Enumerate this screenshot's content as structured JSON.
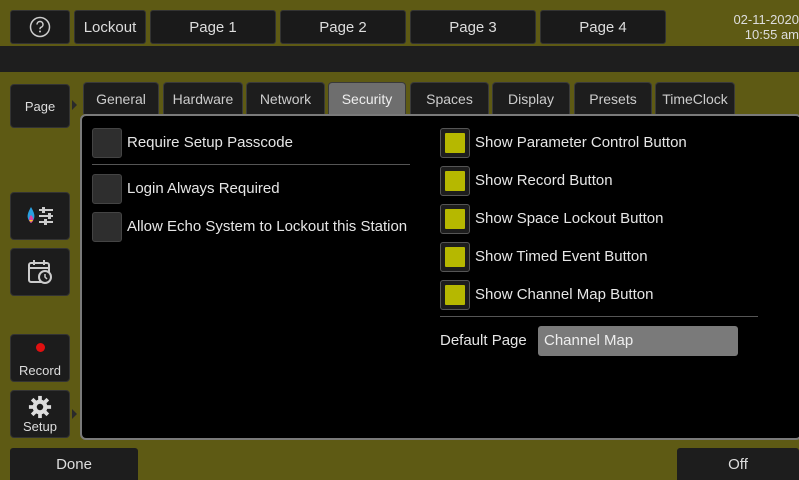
{
  "topbar": {
    "help_icon": "question-circle-icon",
    "lockout_label": "Lockout",
    "pages": [
      "Page 1",
      "Page 2",
      "Page 3",
      "Page 4"
    ],
    "date": "02-11-2020",
    "time": "10:55 am"
  },
  "sidebar": {
    "page_label": "Page",
    "record_label": "Record",
    "setup_label": "Setup",
    "record_dot_color": "#e01010"
  },
  "tabs": [
    "General",
    "Hardware",
    "Network",
    "Security",
    "Spaces",
    "Display",
    "Presets",
    "TimeClock"
  ],
  "active_tab": "Security",
  "security": {
    "left_options": [
      {
        "label": "Require Setup Passcode",
        "checked": false
      },
      {
        "label": "Login Always Required",
        "checked": false
      },
      {
        "label": "Allow Echo System to Lockout this Station",
        "checked": false
      }
    ],
    "right_options": [
      {
        "label": "Show Parameter Control Button",
        "checked": true
      },
      {
        "label": "Show Record Button",
        "checked": true
      },
      {
        "label": "Show Space Lockout Button",
        "checked": true
      },
      {
        "label": "Show Timed Event Button",
        "checked": true
      },
      {
        "label": "Show Channel Map Button",
        "checked": true
      }
    ],
    "default_page_label": "Default Page",
    "default_page_value": "Channel Map"
  },
  "bottombar": {
    "done_label": "Done",
    "off_label": "Off"
  },
  "colors": {
    "accent": "#b6b800",
    "frame": "#5e5a14"
  }
}
